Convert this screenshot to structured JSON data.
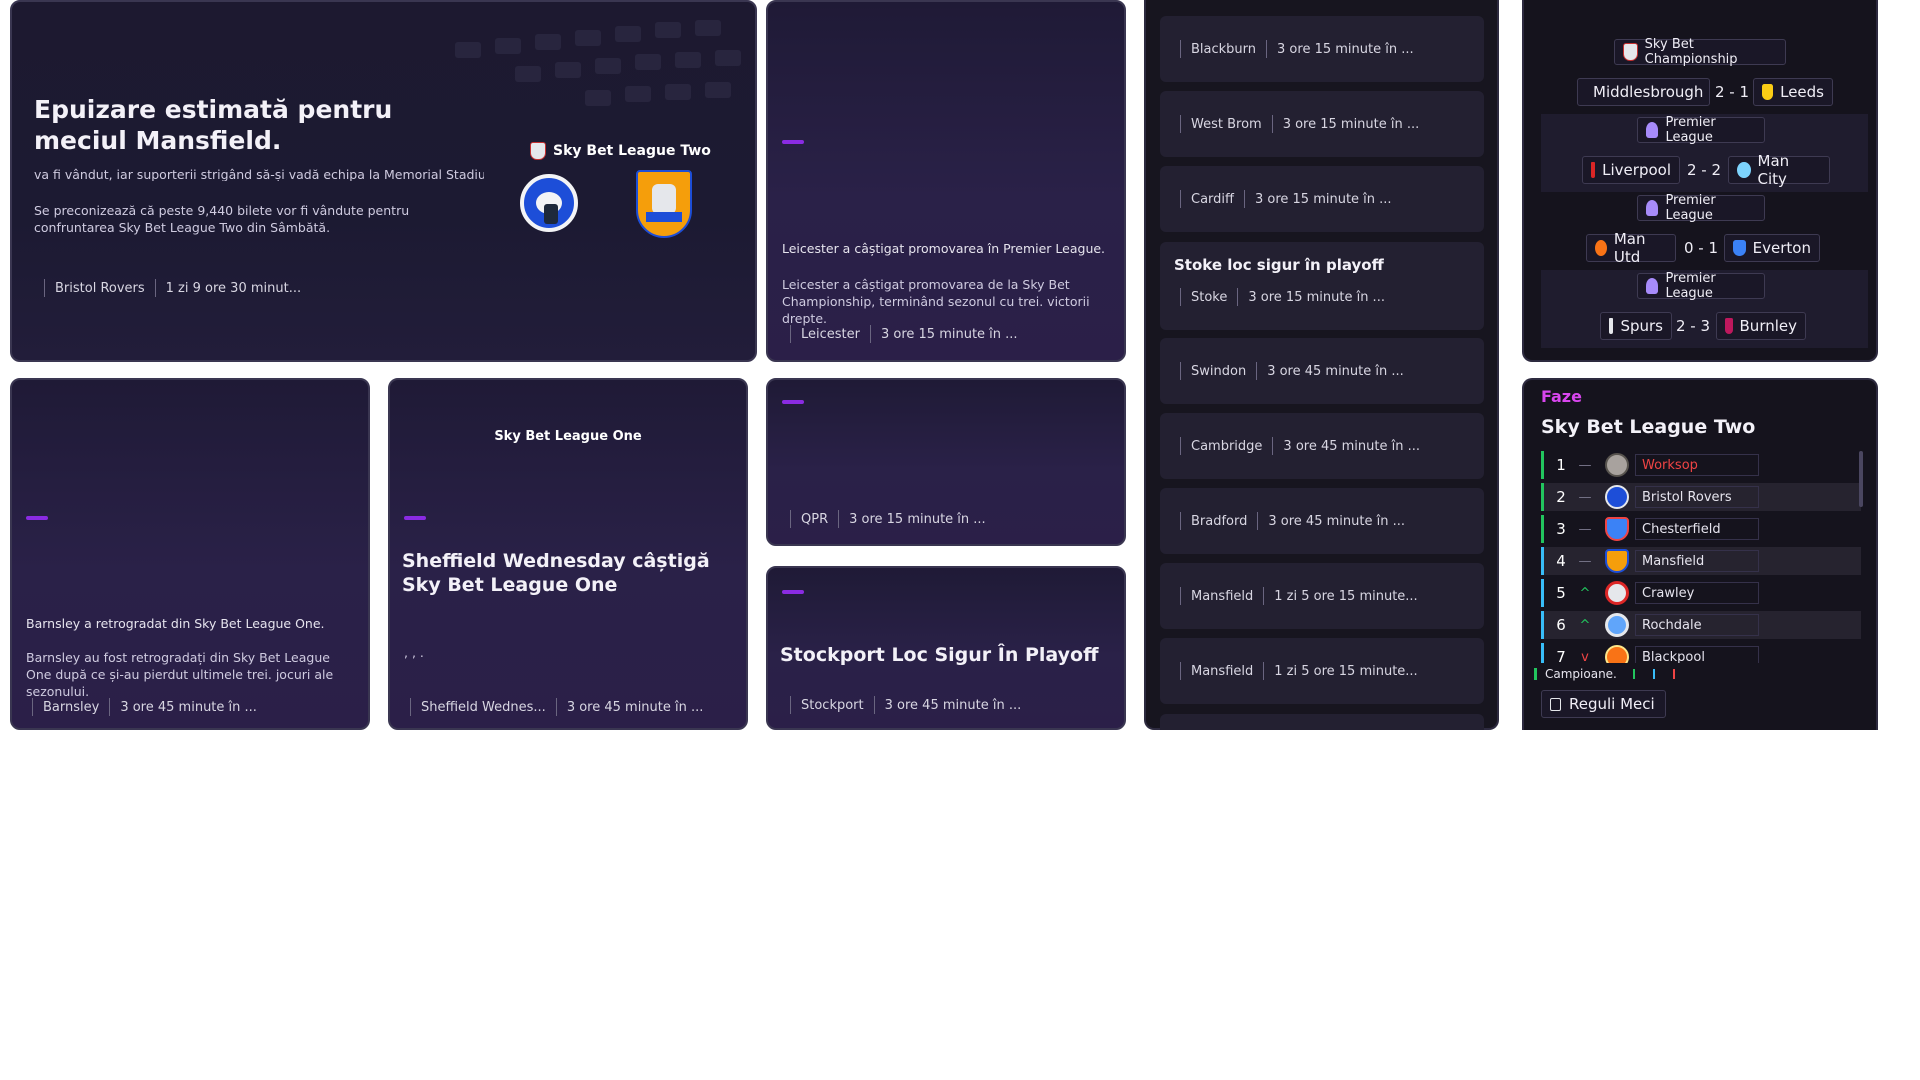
{
  "hero": {
    "title": "Epuizare estimată pentru meciul Mansfield.",
    "cut_line": "va fi vândut, iar suporterii strigând să-și vadă echipa la Memorial Stadium.",
    "paragraph": "Se preconizează că peste 9,440 bilete vor fi vândute pentru confruntarea Sky Bet League Two din Sâmbătă.",
    "league_label": "Sky Bet League Two",
    "team": "Bristol Rovers",
    "time": "1 zi 9 ore 30 minut..."
  },
  "leicester_card": {
    "headline": "Leicester a câștigat promovarea în Premier League.",
    "paragraph": "Leicester a câștigat promovarea de la Sky Bet Championship, terminând sezonul cu trei. victorii drepte.",
    "team": "Leicester",
    "time": "3 ore 15 minute în ..."
  },
  "barnsley_card": {
    "headline": "Barnsley a retrogradat din Sky Bet League One.",
    "paragraph": "Barnsley au fost retrogradați din Sky Bet League One după ce și-au pierdut ultimele trei. jocuri ale sezonului.",
    "team": "Barnsley",
    "time": "3 ore 45 minute în ..."
  },
  "sheffield_card": {
    "league_label": "Sky Bet League One",
    "title": "Sheffield Wednesday câștigă Sky Bet League One",
    "snippet": ", , .",
    "team": "Sheffield Wednes...",
    "time": "3 ore 45 minute în ..."
  },
  "qpr_card": {
    "team": "QPR",
    "time": "3 ore 15 minute în ..."
  },
  "stockport_card": {
    "title": "Stockport Loc Sigur În Playoff",
    "team": "Stockport",
    "time": "3 ore 45 minute în ..."
  },
  "feed": [
    {
      "team": "Blackburn",
      "time": "3 ore 15 minute în ..."
    },
    {
      "team": "West Brom",
      "time": "3 ore 15 minute în ..."
    },
    {
      "team": "Cardiff",
      "time": "3 ore 15 minute în ..."
    },
    {
      "title": "Stoke loc sigur în playoff",
      "team": "Stoke",
      "time": "3 ore 15 minute în ..."
    },
    {
      "team": "Swindon",
      "time": "3 ore 45 minute în ..."
    },
    {
      "team": "Cambridge",
      "time": "3 ore 45 minute în ..."
    },
    {
      "team": "Bradford",
      "time": "3 ore 45 minute în ..."
    },
    {
      "team": "Mansfield",
      "time": "1 zi 5 ore 15 minute..."
    },
    {
      "team": "Mansfield",
      "time": "1 zi 5 ore 15 minute..."
    }
  ],
  "scores": [
    {
      "league": "Sky Bet Championship",
      "home": "Middlesbrough",
      "score": "2 - 1",
      "away": "Leeds"
    },
    {
      "league": "Premier League",
      "home": "Liverpool",
      "score": "2 - 2",
      "away": "Man City"
    },
    {
      "league": "Premier League",
      "home": "Man Utd",
      "score": "0 - 1",
      "away": "Everton"
    },
    {
      "league": "Premier League",
      "home": "Spurs",
      "score": "2 - 3",
      "away": "Burnley"
    }
  ],
  "standings": {
    "phase_label": "Faze",
    "league": "Sky Bet League Two",
    "rows": [
      {
        "rank": "1",
        "trend": "—",
        "team": "Worksop"
      },
      {
        "rank": "2",
        "trend": "—",
        "team": "Bristol Rovers"
      },
      {
        "rank": "3",
        "trend": "—",
        "team": "Chesterfield"
      },
      {
        "rank": "4",
        "trend": "—",
        "team": "Mansfield"
      },
      {
        "rank": "5",
        "trend": "^",
        "team": "Crawley"
      },
      {
        "rank": "6",
        "trend": "^",
        "team": "Rochdale"
      },
      {
        "rank": "7",
        "trend": "v",
        "team": "Blackpool"
      }
    ],
    "legend_label": "Campioane.",
    "rules_button": "Reguli Meci"
  },
  "colors": {
    "accent_purple": "#8a2be2",
    "phase_pink": "#d946ef",
    "leader_red": "#ef4444",
    "promotion_green": "#22c55e",
    "relegation_red": "#ef4444"
  },
  "icons": {
    "league": "shield-icon",
    "rules": "document-icon",
    "trend_up": "chevron-up-icon",
    "trend_down": "chevron-down-icon"
  }
}
